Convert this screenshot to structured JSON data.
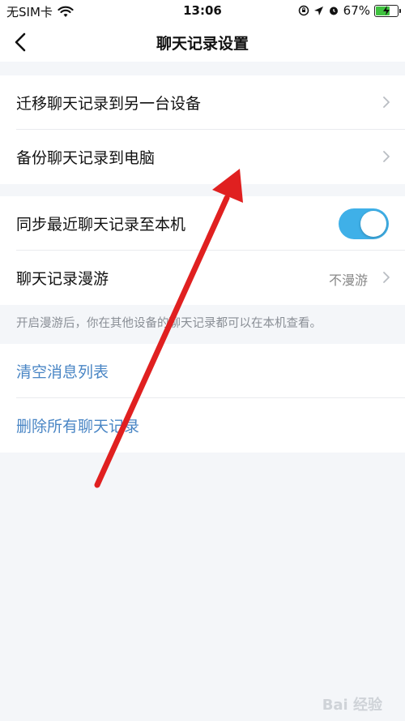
{
  "status_bar": {
    "carrier": "无SIM卡",
    "time": "13:06",
    "battery_percent": "67%",
    "battery_level": 0.67,
    "icons": [
      "wifi-icon",
      "orientation-lock-icon",
      "location-icon",
      "alarm-icon",
      "battery-charging-icon"
    ]
  },
  "nav": {
    "title": "聊天记录设置",
    "back_icon": "chevron-left-icon"
  },
  "group1": {
    "items": [
      {
        "label": "迁移聊天记录到另一台设备"
      },
      {
        "label": "备份聊天记录到电脑"
      }
    ]
  },
  "group2": {
    "sync_label": "同步最近聊天记录至本机",
    "sync_on": true,
    "roam_label": "聊天记录漫游",
    "roam_value": "不漫游"
  },
  "hint": "开启漫游后，你在其他设备的聊天记录都可以在本机查看。",
  "group3": {
    "clear_label": "清空消息列表",
    "delete_label": "删除所有聊天记录"
  },
  "colors": {
    "accent_blue": "#4a86c5",
    "toggle_on": "#3fb0e8",
    "annotation_arrow": "#e02020",
    "background": "#f4f6f9"
  },
  "watermark": "Bai 经验"
}
